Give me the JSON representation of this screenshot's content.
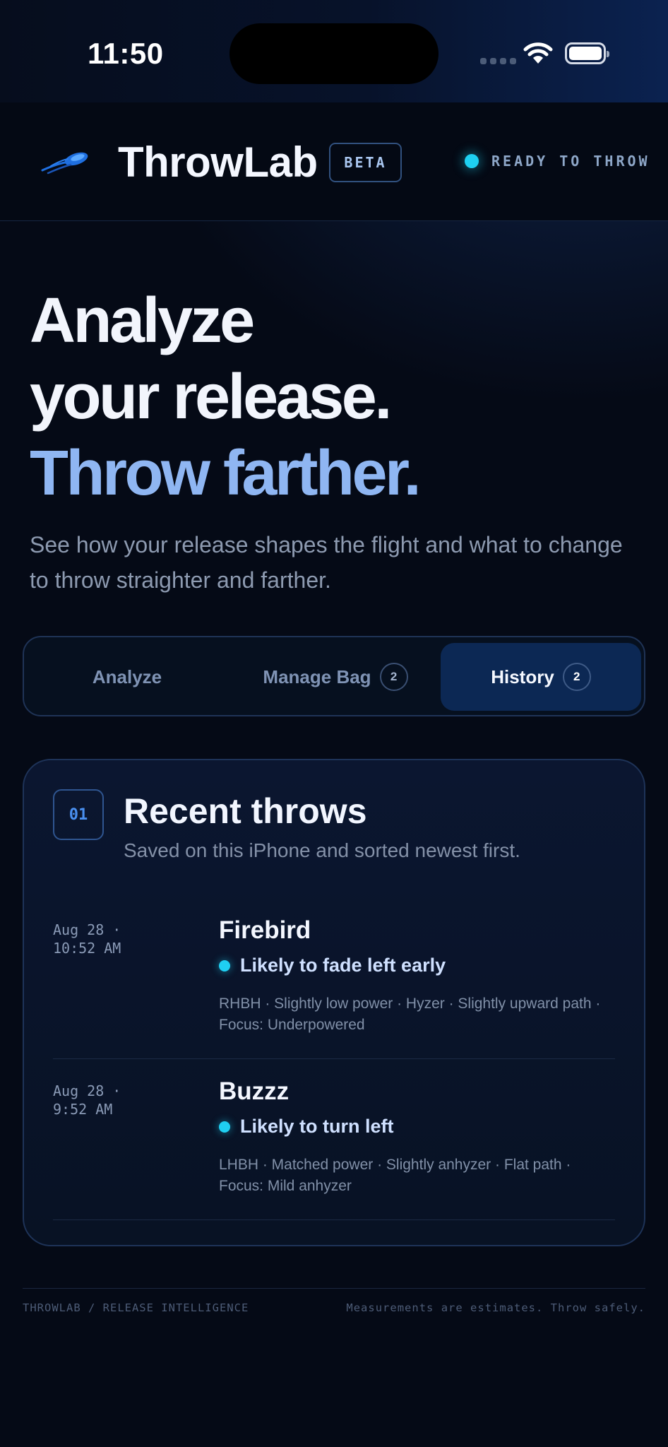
{
  "status_bar": {
    "time": "11:50"
  },
  "header": {
    "app_name": "ThrowLab",
    "badge": "BETA",
    "status": "READY TO THROW",
    "accent": "#1ed0f2"
  },
  "hero": {
    "line1": "Analyze",
    "line2": "your release.",
    "line3": "Throw farther.",
    "subtitle": "See how your release shapes the flight and what to change to throw straighter and farther."
  },
  "tabs": [
    {
      "label": "Analyze",
      "count": null,
      "active": false
    },
    {
      "label": "Manage Bag",
      "count": "2",
      "active": false
    },
    {
      "label": "History",
      "count": "2",
      "active": true
    }
  ],
  "history": {
    "number": "01",
    "title": "Recent throws",
    "subtitle": "Saved on this iPhone and sorted newest first.",
    "throws": [
      {
        "date": "Aug 28 ·",
        "time": "10:52 AM",
        "disc": "Firebird",
        "verdict": "Likely to fade left early",
        "detail": "RHBH · Slightly low power · Hyzer · Slightly upward path · Focus: Underpowered"
      },
      {
        "date": "Aug 28 ·",
        "time": "9:52 AM",
        "disc": "Buzzz",
        "verdict": "Likely to turn left",
        "detail": "LHBH · Matched power · Slightly anhyzer · Flat path · Focus: Mild anhyzer"
      }
    ]
  },
  "footer": {
    "left": "THROWLAB / RELEASE INTELLIGENCE",
    "right": "Measurements are estimates. Throw safely."
  }
}
